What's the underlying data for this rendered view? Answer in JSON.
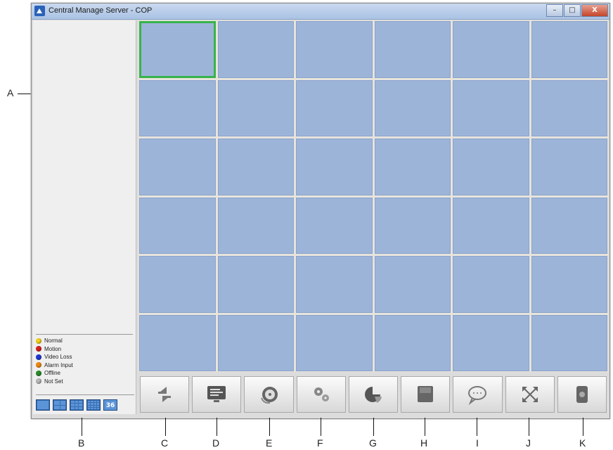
{
  "window": {
    "title": "Central Manage Server - COP",
    "minimize_label": "–",
    "maximize_label": "□",
    "close_label": "X"
  },
  "callouts": {
    "A": "A",
    "B": "B",
    "C": "C",
    "D": "D",
    "E": "E",
    "F": "F",
    "G": "G",
    "H": "H",
    "I": "I",
    "J": "J",
    "K": "K"
  },
  "legend": [
    {
      "label": "Normal",
      "color": "#f2d21a"
    },
    {
      "label": "Motion",
      "color": "#d8201c"
    },
    {
      "label": "Video Loss",
      "color": "#1f38d6"
    },
    {
      "label": "Alarm Input",
      "color": "#ee8a12"
    },
    {
      "label": "Offline",
      "color": "#2a8c2a"
    },
    {
      "label": "Not Set",
      "color": "#b8b8b8"
    }
  ],
  "layout_buttons": {
    "n36_label": "36"
  },
  "video_grid": {
    "rows": 6,
    "columns": 6,
    "selected_cell": 1
  },
  "toolbar": [
    {
      "icon": "switch-arrows-icon"
    },
    {
      "icon": "monitor-icon"
    },
    {
      "icon": "playback-reel-icon"
    },
    {
      "icon": "settings-gears-icon"
    },
    {
      "icon": "pie-chart-icon"
    },
    {
      "icon": "save-icon"
    },
    {
      "icon": "chat-bubble-icon"
    },
    {
      "icon": "fullscreen-arrows-icon"
    },
    {
      "icon": "camera-icon"
    }
  ],
  "colors": {
    "cell_fill": "#9db4d9",
    "selected_border": "#37b34a",
    "titlebar": "#aac3e4"
  }
}
